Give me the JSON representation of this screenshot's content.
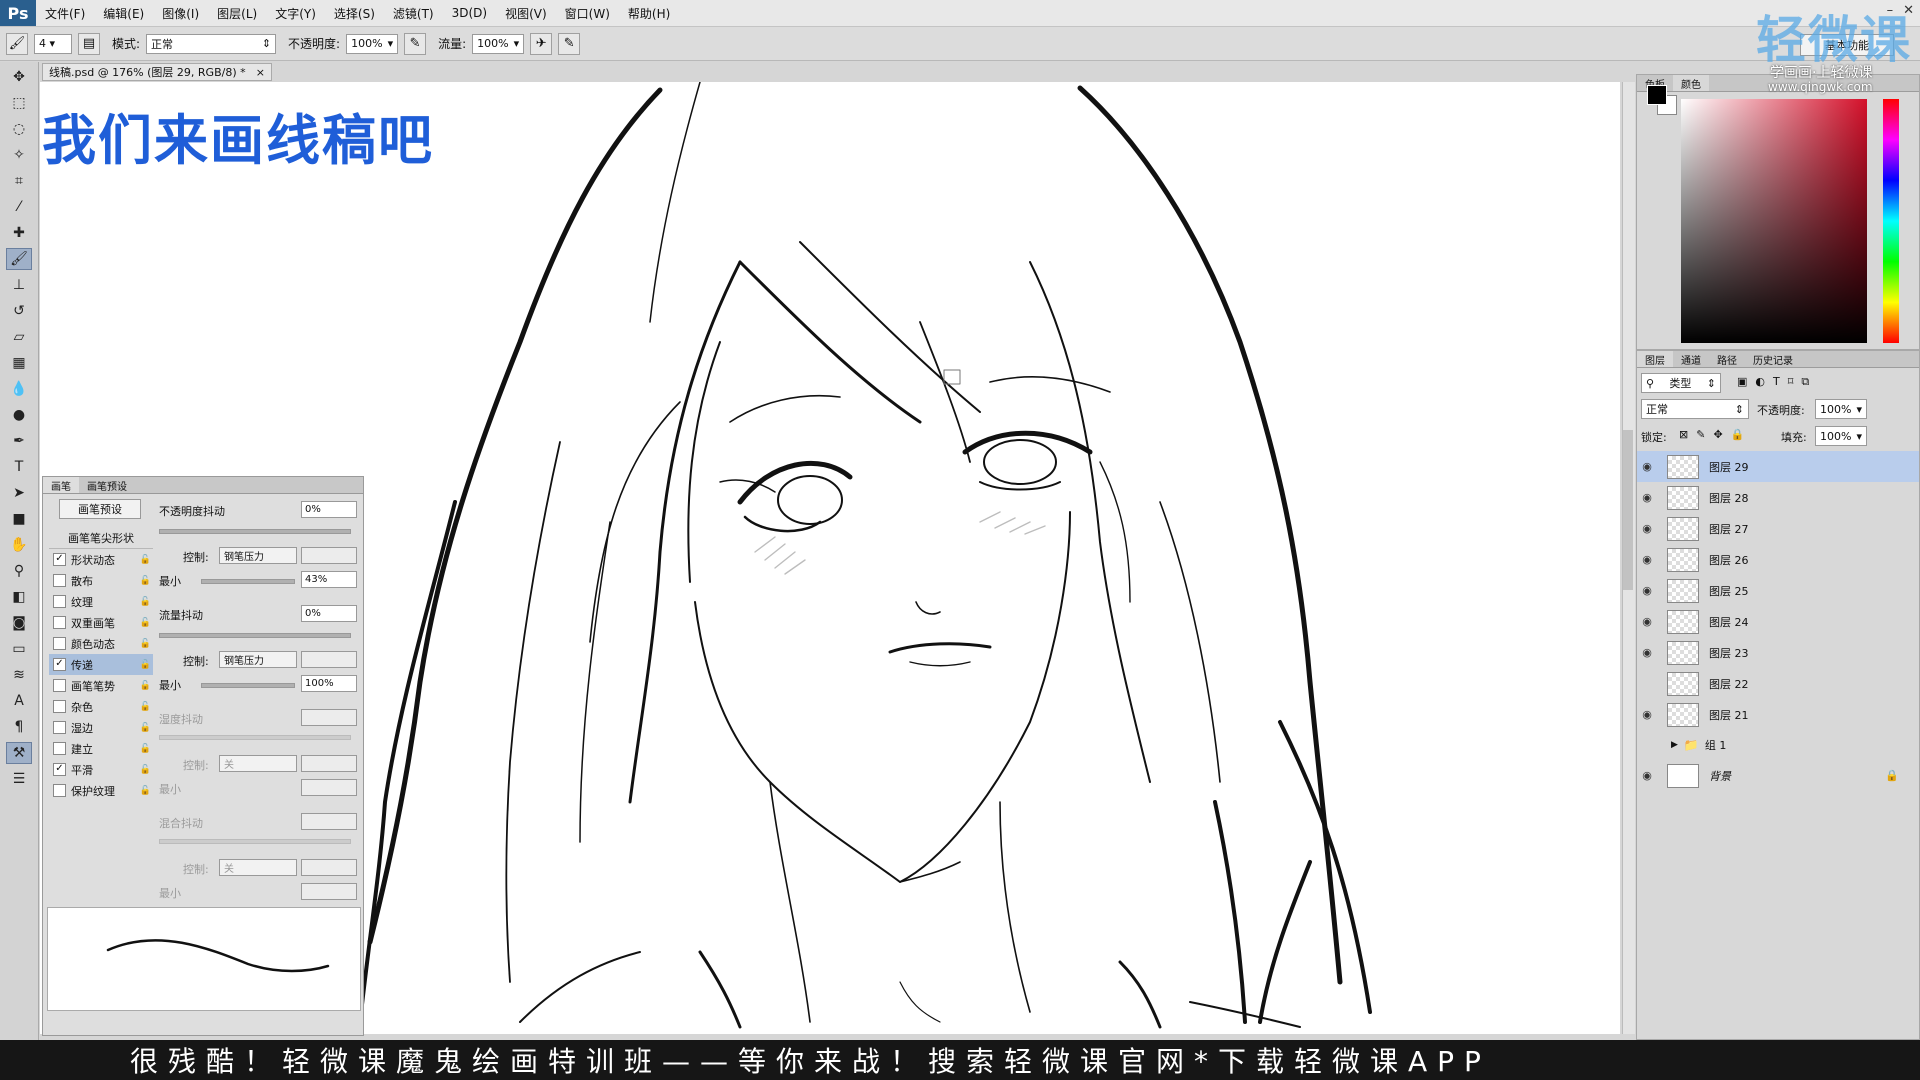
{
  "app": {
    "logo": "Ps"
  },
  "menu": [
    "文件(F)",
    "编辑(E)",
    "图像(I)",
    "图层(L)",
    "文字(Y)",
    "选择(S)",
    "滤镜(T)",
    "3D(D)",
    "视图(V)",
    "窗口(W)",
    "帮助(H)"
  ],
  "window_controls": {
    "minimize": "–",
    "close": "✕"
  },
  "options": {
    "brush_size": "4",
    "mode_label": "模式:",
    "mode_value": "正常",
    "opacity_label": "不透明度:",
    "opacity_value": "100%",
    "flow_label": "流量:",
    "flow_value": "100%",
    "workspace": "基本功能"
  },
  "document": {
    "tab": "线稿.psd @ 176% (图层 29, RGB/8) *",
    "close": "×"
  },
  "overlay": {
    "title": "我们来画线稿吧"
  },
  "brush_panel": {
    "tabs": [
      "画笔",
      "画笔预设"
    ],
    "preset_button": "画笔预设",
    "tip_shape_header": "画笔笔尖形状",
    "options": [
      {
        "label": "形状动态",
        "checked": true,
        "selected": false
      },
      {
        "label": "散布",
        "checked": false,
        "selected": false
      },
      {
        "label": "纹理",
        "checked": false,
        "selected": false
      },
      {
        "label": "双重画笔",
        "checked": false,
        "selected": false
      },
      {
        "label": "颜色动态",
        "checked": false,
        "selected": false
      },
      {
        "label": "传递",
        "checked": true,
        "selected": true
      },
      {
        "label": "画笔笔势",
        "checked": false,
        "selected": false
      },
      {
        "label": "杂色",
        "checked": false,
        "selected": false
      },
      {
        "label": "湿边",
        "checked": false,
        "selected": false
      },
      {
        "label": "建立",
        "checked": false,
        "selected": false
      },
      {
        "label": "平滑",
        "checked": true,
        "selected": false
      },
      {
        "label": "保护纹理",
        "checked": false,
        "selected": false
      }
    ],
    "opacity_jitter_label": "不透明度抖动",
    "opacity_jitter_value": "0%",
    "control_label": "控制:",
    "control_value": "钢笔压力",
    "min_label": "最小",
    "opacity_min_value": "43%",
    "flow_jitter_label": "流量抖动",
    "flow_jitter_value": "0%",
    "flow_control_value": "钢笔压力",
    "flow_min_value": "100%",
    "wet_jitter_label": "湿度抖动",
    "wet_control_value": "关",
    "mix_jitter_label": "混合抖动",
    "mix_control_value": "关"
  },
  "color_panel": {
    "tabs": [
      "色板",
      "颜色"
    ]
  },
  "layers_panel": {
    "tabs": [
      "图层",
      "通道",
      "路径",
      "历史记录"
    ],
    "filter_value": "类型",
    "blend_mode": "正常",
    "opacity_label": "不透明度:",
    "opacity_value": "100%",
    "lock_label": "锁定:",
    "fill_label": "填充:",
    "fill_value": "100%",
    "layers": [
      {
        "name": "图层 29",
        "visible": true,
        "selected": true
      },
      {
        "name": "图层 28",
        "visible": true,
        "selected": false
      },
      {
        "name": "图层 27",
        "visible": true,
        "selected": false
      },
      {
        "name": "图层 26",
        "visible": true,
        "selected": false
      },
      {
        "name": "图层 25",
        "visible": true,
        "selected": false
      },
      {
        "name": "图层 24",
        "visible": true,
        "selected": false
      },
      {
        "name": "图层 23",
        "visible": true,
        "selected": false
      },
      {
        "name": "图层 22",
        "visible": false,
        "selected": false
      },
      {
        "name": "图层 21",
        "visible": true,
        "selected": false
      }
    ],
    "group": "组 1",
    "background": "背景"
  },
  "watermark": {
    "main": "轻微课",
    "sub": "学画画·上轻微课",
    "url": "www.qingwk.com"
  },
  "banner": "很残酷！轻微课魔鬼绘画特训班——等你来战！搜索轻微课官网*下载轻微课APP",
  "colors": {
    "selected_layer": "#b9cdec",
    "title_blue": "#1f5ed8",
    "banner_bg": "#161616"
  }
}
